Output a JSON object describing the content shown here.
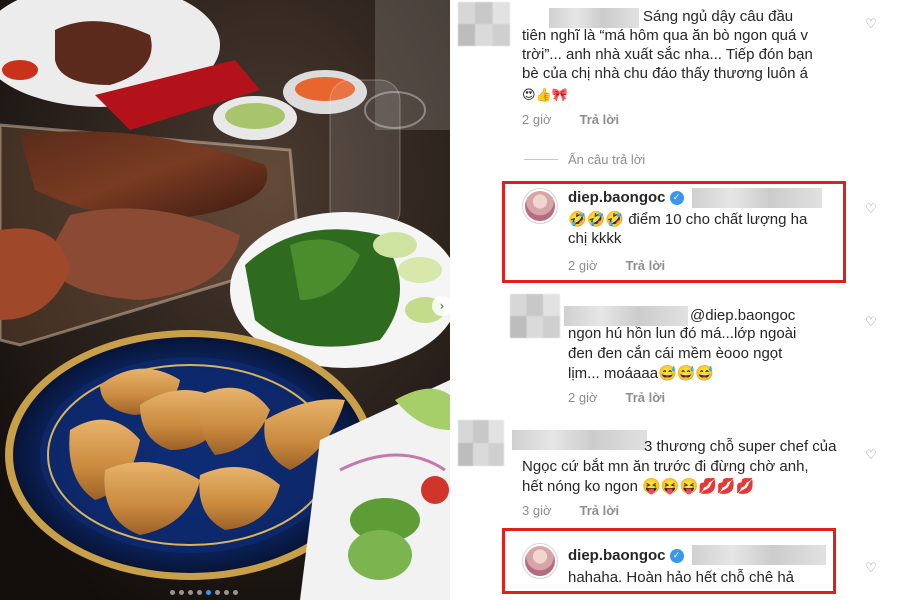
{
  "photo": {
    "carousel_next": "›",
    "dot_count": 8,
    "active_dot": 5
  },
  "comments": [
    {
      "text_lines": [
        "Sáng ngủ dậy câu đầu",
        "tiên nghĩ là “má hôm qua ăn bò ngon quá v",
        "trời”... anh nhà xuất sắc nha... Tiếp đón bạn",
        "bè của chị nhà chu đáo thấy thương luôn á"
      ],
      "emoji_line": "😍👍🎀",
      "time": "2 giờ",
      "reply": "Trả lời"
    },
    {
      "hide_replies": "Ẩn câu trả lời"
    },
    {
      "username": "diep.baongoc",
      "text_lines": [
        "🤣🤣🤣 điểm 10 cho chất lượng ha",
        "chị kkkk"
      ],
      "time": "2 giờ",
      "reply": "Trả lời"
    },
    {
      "mention": "@diep.baongoc",
      "text_lines": [
        "ngon hú hồn lun đó má...lớp ngoài",
        "đen đen cắn cái mềm èooo ngọt",
        "lịm... moáaaa😅😅😅"
      ],
      "time": "2 giờ",
      "reply": "Trả lời"
    },
    {
      "text_lines": [
        "3 thương chỗ super chef của",
        "Ngọc cứ bắt mn ăn trước đi đừng chờ anh,",
        "hết nóng ko ngon 😝😝😝💋💋💋"
      ],
      "time": "3 giờ",
      "reply": "Trả lời"
    },
    {
      "username": "diep.baongoc",
      "text_lines": [
        "hahaha. Hoàn hảo hết chỗ chê hả"
      ]
    }
  ],
  "icons": {
    "heart": "♡",
    "verified": "✓"
  },
  "colors": {
    "highlight_box": "#e0201b",
    "verified": "#3897f0",
    "meta_text": "#8e8e8e"
  }
}
